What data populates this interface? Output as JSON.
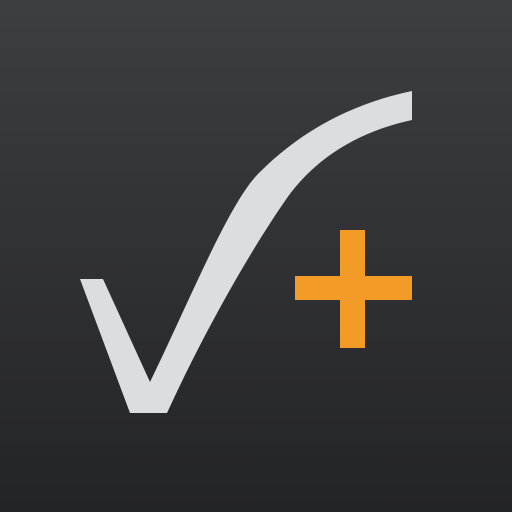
{
  "icon": {
    "name": "check-plus",
    "colors": {
      "background_top": "#3d3e42",
      "background_bottom": "#232427",
      "check": "#dcdde1",
      "plus": "#f29b27"
    }
  }
}
